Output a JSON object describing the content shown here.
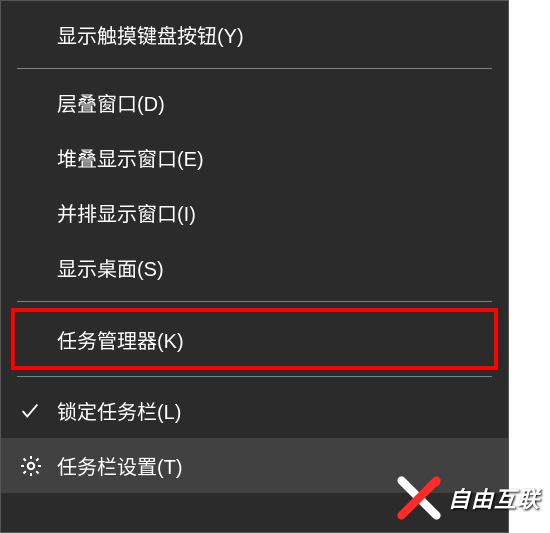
{
  "menu": {
    "items": [
      {
        "label": "显示触摸键盘按钮(Y)"
      },
      {
        "label": "层叠窗口(D)"
      },
      {
        "label": "堆叠显示窗口(E)"
      },
      {
        "label": "并排显示窗口(I)"
      },
      {
        "label": "显示桌面(S)"
      },
      {
        "label": "任务管理器(K)"
      },
      {
        "label": "锁定任务栏(L)"
      },
      {
        "label": "任务栏设置(T)"
      }
    ]
  },
  "watermark": {
    "text": "自由互联"
  },
  "highlight_color": "#ff0000"
}
